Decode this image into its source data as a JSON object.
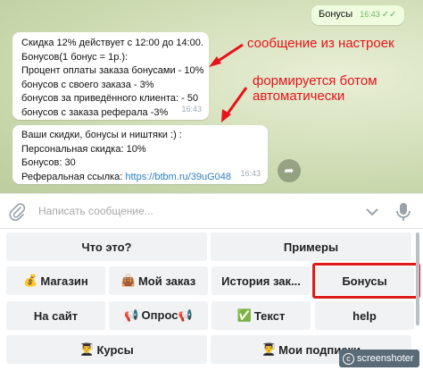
{
  "chat": {
    "outgoing": {
      "text": "Бонусы",
      "time": "16:43"
    },
    "message1": {
      "lines": [
        "Скидка 12% действует с 12:00 до 14:00.",
        "Бонусов(1 бонус = 1р.):",
        "Процент оплаты заказа бонусами - 10%",
        "бонусов с своего заказа - 3%",
        "бонусов за приведённого клиента: - 50",
        "бонусов с заказа реферала -3%"
      ],
      "time": "16:43"
    },
    "message2": {
      "lines": [
        "Ваши скидки, бонусы и ништяки :) :",
        "Персональная скидка: 10%",
        "Бонусов: 30"
      ],
      "ref_label": "Реферальная ссылка:",
      "ref_link": "https://btbm.ru/39uG048",
      "time": "16:43"
    }
  },
  "annotations": {
    "a1": "сообщение из настроек",
    "a2_line1": "формируется ботом",
    "a2_line2": "автоматически",
    "color": "#e8121b"
  },
  "input": {
    "placeholder": "Написать сообщение..."
  },
  "keyboard": {
    "row1": [
      "Что это?",
      "Примеры"
    ],
    "row2": [
      {
        "emoji": "💰",
        "label": "Магазин"
      },
      {
        "emoji": "👜",
        "label": "Мой заказ"
      },
      {
        "emoji": "",
        "label": "История зак..."
      },
      {
        "emoji": "",
        "label": "Бонусы"
      }
    ],
    "row3": [
      {
        "emoji": "",
        "label": "На сайт"
      },
      {
        "emoji": "📢",
        "label": "Опрос📢"
      },
      {
        "emoji": "✅",
        "label": "Текст"
      },
      {
        "emoji": "",
        "label": "help"
      }
    ],
    "row4": [
      {
        "emoji": "👨‍🎓",
        "label": "Курсы"
      },
      {
        "emoji": "👨‍🎓",
        "label": "Мои подписки"
      }
    ]
  },
  "watermark": {
    "text": "screenshoter"
  }
}
